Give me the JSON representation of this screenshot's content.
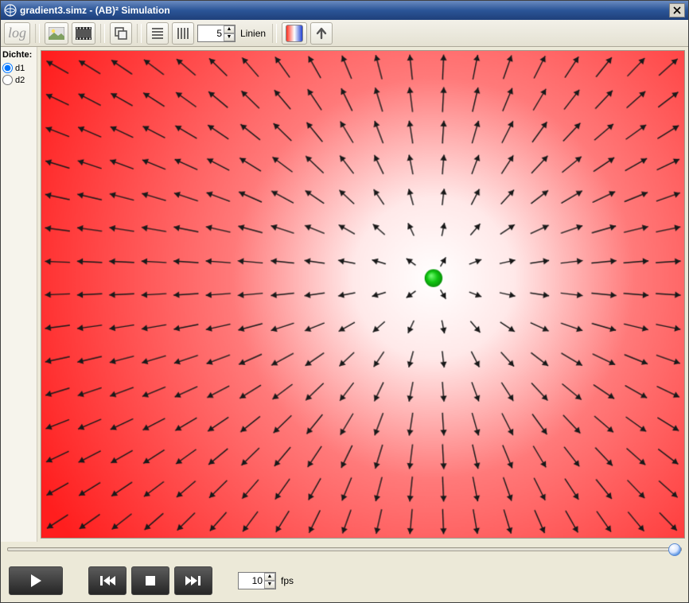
{
  "window": {
    "title": "gradient3.simz - (AB)² Simulation"
  },
  "toolbar": {
    "log_label": "log",
    "lines_field_value": "5",
    "lines_label": "Linien"
  },
  "sidebar": {
    "heading": "Dichte:",
    "options": [
      {
        "label": "d1",
        "checked": true
      },
      {
        "label": "d2",
        "checked": false
      }
    ]
  },
  "viz": {
    "cols": 20,
    "rows": 15,
    "center_col": 12.2,
    "center_row": 7.0,
    "marker_color": "#11c411",
    "bg_inner": "#ffffff",
    "bg_outer": "#ff1e1e",
    "arrow_color": "#1a1a1a"
  },
  "playback": {
    "fps_value": "10",
    "fps_label": "fps"
  }
}
